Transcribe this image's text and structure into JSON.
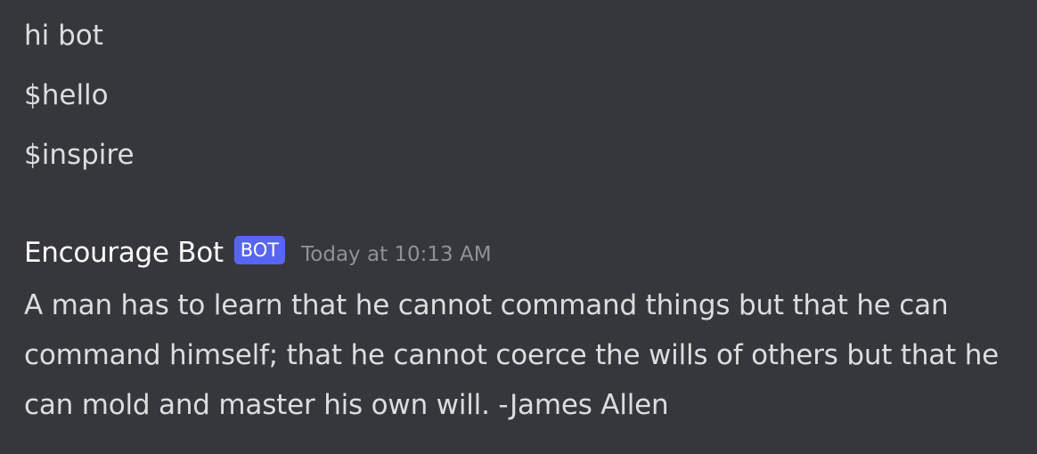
{
  "messages": {
    "previous": [
      {
        "text": "hi bot"
      },
      {
        "text": "$hello"
      },
      {
        "text": "$inspire"
      }
    ],
    "bot_reply": {
      "author": "Encourage Bot",
      "tag": "BOT",
      "timestamp": "Today at 10:13 AM",
      "text": "A man has to learn that he cannot command things but that he can command himself; that he cannot coerce the wills of others but that he can mold and master his own will. -James Allen"
    }
  },
  "colors": {
    "background": "#36373c",
    "text": "#dcddde",
    "author": "#ffffff",
    "bot_tag": "#5865f2",
    "timestamp": "#8e9297"
  }
}
